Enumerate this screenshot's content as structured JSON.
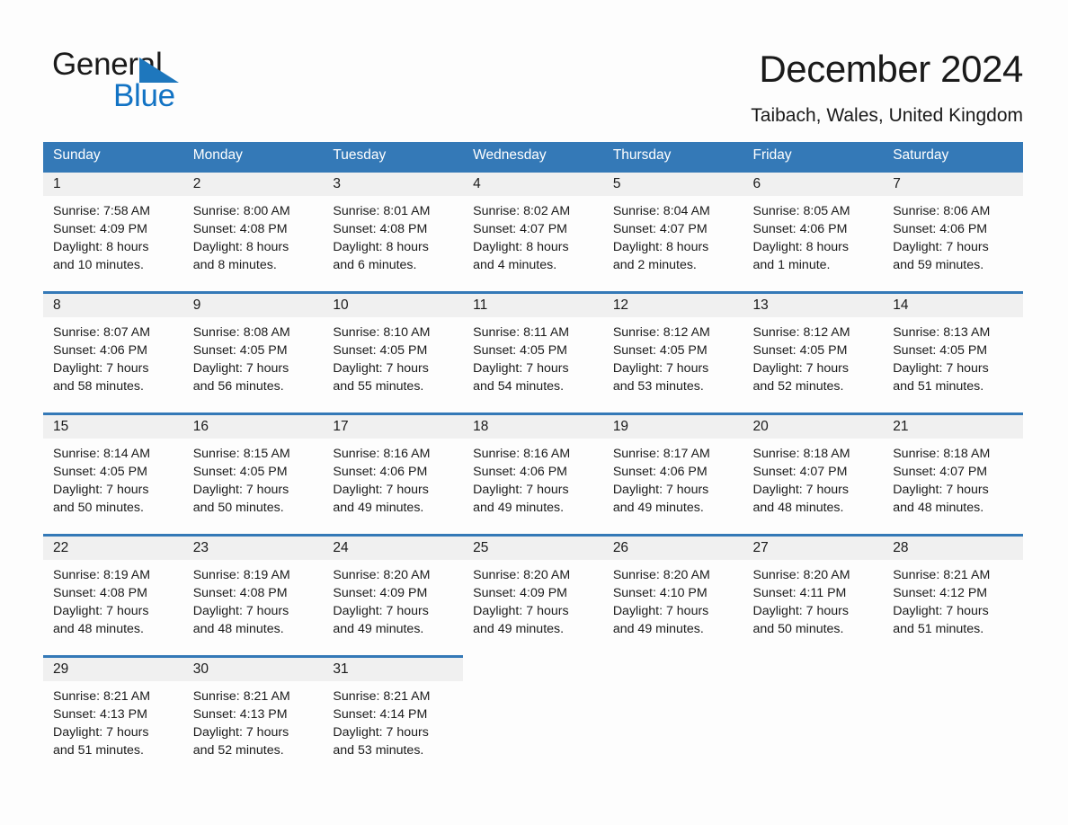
{
  "logo": {
    "word_top": "General",
    "word_bottom": "Blue",
    "triangle_color": "#1e77bd",
    "blue_color": "#1273c4"
  },
  "header": {
    "title": "December 2024",
    "subtitle": "Taibach, Wales, United Kingdom"
  },
  "colors": {
    "header_blue": "#3479b7",
    "row_rule_blue": "#3479b7",
    "daynum_band": "#f0f0f0",
    "page_bg": "#fdfdfd",
    "text": "#1a1a1a"
  },
  "weekday_headers": [
    "Sunday",
    "Monday",
    "Tuesday",
    "Wednesday",
    "Thursday",
    "Friday",
    "Saturday"
  ],
  "labels": {
    "sunrise_prefix": "Sunrise:",
    "sunset_prefix": "Sunset:",
    "daylight_prefix": "Daylight:"
  },
  "weeks": [
    [
      {
        "day": "1",
        "sunrise": "Sunrise: 7:58 AM",
        "sunset": "Sunset: 4:09 PM",
        "daylight_line1": "Daylight: 8 hours",
        "daylight_line2": "and 10 minutes."
      },
      {
        "day": "2",
        "sunrise": "Sunrise: 8:00 AM",
        "sunset": "Sunset: 4:08 PM",
        "daylight_line1": "Daylight: 8 hours",
        "daylight_line2": "and 8 minutes."
      },
      {
        "day": "3",
        "sunrise": "Sunrise: 8:01 AM",
        "sunset": "Sunset: 4:08 PM",
        "daylight_line1": "Daylight: 8 hours",
        "daylight_line2": "and 6 minutes."
      },
      {
        "day": "4",
        "sunrise": "Sunrise: 8:02 AM",
        "sunset": "Sunset: 4:07 PM",
        "daylight_line1": "Daylight: 8 hours",
        "daylight_line2": "and 4 minutes."
      },
      {
        "day": "5",
        "sunrise": "Sunrise: 8:04 AM",
        "sunset": "Sunset: 4:07 PM",
        "daylight_line1": "Daylight: 8 hours",
        "daylight_line2": "and 2 minutes."
      },
      {
        "day": "6",
        "sunrise": "Sunrise: 8:05 AM",
        "sunset": "Sunset: 4:06 PM",
        "daylight_line1": "Daylight: 8 hours",
        "daylight_line2": "and 1 minute."
      },
      {
        "day": "7",
        "sunrise": "Sunrise: 8:06 AM",
        "sunset": "Sunset: 4:06 PM",
        "daylight_line1": "Daylight: 7 hours",
        "daylight_line2": "and 59 minutes."
      }
    ],
    [
      {
        "day": "8",
        "sunrise": "Sunrise: 8:07 AM",
        "sunset": "Sunset: 4:06 PM",
        "daylight_line1": "Daylight: 7 hours",
        "daylight_line2": "and 58 minutes."
      },
      {
        "day": "9",
        "sunrise": "Sunrise: 8:08 AM",
        "sunset": "Sunset: 4:05 PM",
        "daylight_line1": "Daylight: 7 hours",
        "daylight_line2": "and 56 minutes."
      },
      {
        "day": "10",
        "sunrise": "Sunrise: 8:10 AM",
        "sunset": "Sunset: 4:05 PM",
        "daylight_line1": "Daylight: 7 hours",
        "daylight_line2": "and 55 minutes."
      },
      {
        "day": "11",
        "sunrise": "Sunrise: 8:11 AM",
        "sunset": "Sunset: 4:05 PM",
        "daylight_line1": "Daylight: 7 hours",
        "daylight_line2": "and 54 minutes."
      },
      {
        "day": "12",
        "sunrise": "Sunrise: 8:12 AM",
        "sunset": "Sunset: 4:05 PM",
        "daylight_line1": "Daylight: 7 hours",
        "daylight_line2": "and 53 minutes."
      },
      {
        "day": "13",
        "sunrise": "Sunrise: 8:12 AM",
        "sunset": "Sunset: 4:05 PM",
        "daylight_line1": "Daylight: 7 hours",
        "daylight_line2": "and 52 minutes."
      },
      {
        "day": "14",
        "sunrise": "Sunrise: 8:13 AM",
        "sunset": "Sunset: 4:05 PM",
        "daylight_line1": "Daylight: 7 hours",
        "daylight_line2": "and 51 minutes."
      }
    ],
    [
      {
        "day": "15",
        "sunrise": "Sunrise: 8:14 AM",
        "sunset": "Sunset: 4:05 PM",
        "daylight_line1": "Daylight: 7 hours",
        "daylight_line2": "and 50 minutes."
      },
      {
        "day": "16",
        "sunrise": "Sunrise: 8:15 AM",
        "sunset": "Sunset: 4:05 PM",
        "daylight_line1": "Daylight: 7 hours",
        "daylight_line2": "and 50 minutes."
      },
      {
        "day": "17",
        "sunrise": "Sunrise: 8:16 AM",
        "sunset": "Sunset: 4:06 PM",
        "daylight_line1": "Daylight: 7 hours",
        "daylight_line2": "and 49 minutes."
      },
      {
        "day": "18",
        "sunrise": "Sunrise: 8:16 AM",
        "sunset": "Sunset: 4:06 PM",
        "daylight_line1": "Daylight: 7 hours",
        "daylight_line2": "and 49 minutes."
      },
      {
        "day": "19",
        "sunrise": "Sunrise: 8:17 AM",
        "sunset": "Sunset: 4:06 PM",
        "daylight_line1": "Daylight: 7 hours",
        "daylight_line2": "and 49 minutes."
      },
      {
        "day": "20",
        "sunrise": "Sunrise: 8:18 AM",
        "sunset": "Sunset: 4:07 PM",
        "daylight_line1": "Daylight: 7 hours",
        "daylight_line2": "and 48 minutes."
      },
      {
        "day": "21",
        "sunrise": "Sunrise: 8:18 AM",
        "sunset": "Sunset: 4:07 PM",
        "daylight_line1": "Daylight: 7 hours",
        "daylight_line2": "and 48 minutes."
      }
    ],
    [
      {
        "day": "22",
        "sunrise": "Sunrise: 8:19 AM",
        "sunset": "Sunset: 4:08 PM",
        "daylight_line1": "Daylight: 7 hours",
        "daylight_line2": "and 48 minutes."
      },
      {
        "day": "23",
        "sunrise": "Sunrise: 8:19 AM",
        "sunset": "Sunset: 4:08 PM",
        "daylight_line1": "Daylight: 7 hours",
        "daylight_line2": "and 48 minutes."
      },
      {
        "day": "24",
        "sunrise": "Sunrise: 8:20 AM",
        "sunset": "Sunset: 4:09 PM",
        "daylight_line1": "Daylight: 7 hours",
        "daylight_line2": "and 49 minutes."
      },
      {
        "day": "25",
        "sunrise": "Sunrise: 8:20 AM",
        "sunset": "Sunset: 4:09 PM",
        "daylight_line1": "Daylight: 7 hours",
        "daylight_line2": "and 49 minutes."
      },
      {
        "day": "26",
        "sunrise": "Sunrise: 8:20 AM",
        "sunset": "Sunset: 4:10 PM",
        "daylight_line1": "Daylight: 7 hours",
        "daylight_line2": "and 49 minutes."
      },
      {
        "day": "27",
        "sunrise": "Sunrise: 8:20 AM",
        "sunset": "Sunset: 4:11 PM",
        "daylight_line1": "Daylight: 7 hours",
        "daylight_line2": "and 50 minutes."
      },
      {
        "day": "28",
        "sunrise": "Sunrise: 8:21 AM",
        "sunset": "Sunset: 4:12 PM",
        "daylight_line1": "Daylight: 7 hours",
        "daylight_line2": "and 51 minutes."
      }
    ],
    [
      {
        "day": "29",
        "sunrise": "Sunrise: 8:21 AM",
        "sunset": "Sunset: 4:13 PM",
        "daylight_line1": "Daylight: 7 hours",
        "daylight_line2": "and 51 minutes."
      },
      {
        "day": "30",
        "sunrise": "Sunrise: 8:21 AM",
        "sunset": "Sunset: 4:13 PM",
        "daylight_line1": "Daylight: 7 hours",
        "daylight_line2": "and 52 minutes."
      },
      {
        "day": "31",
        "sunrise": "Sunrise: 8:21 AM",
        "sunset": "Sunset: 4:14 PM",
        "daylight_line1": "Daylight: 7 hours",
        "daylight_line2": "and 53 minutes."
      },
      {
        "day": "",
        "sunrise": "",
        "sunset": "",
        "daylight_line1": "",
        "daylight_line2": ""
      },
      {
        "day": "",
        "sunrise": "",
        "sunset": "",
        "daylight_line1": "",
        "daylight_line2": ""
      },
      {
        "day": "",
        "sunrise": "",
        "sunset": "",
        "daylight_line1": "",
        "daylight_line2": ""
      },
      {
        "day": "",
        "sunrise": "",
        "sunset": "",
        "daylight_line1": "",
        "daylight_line2": ""
      }
    ]
  ]
}
